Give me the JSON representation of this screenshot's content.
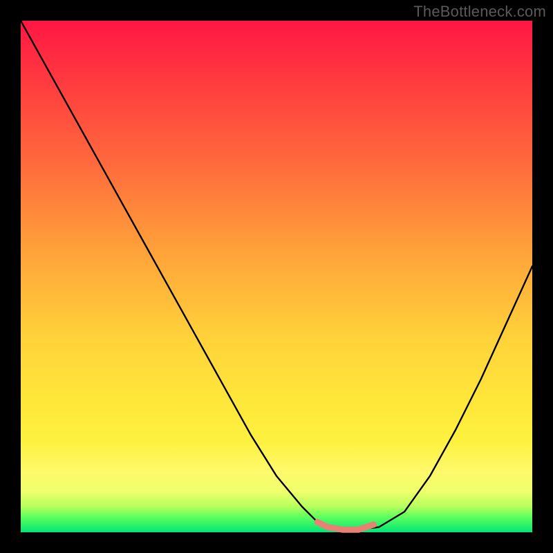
{
  "watermark": "TheBottleneck.com",
  "colors": {
    "frame_bg": "#000000",
    "curve_stroke": "#000000",
    "highlight_stroke": "#e98074",
    "gradient_top": "#ff1744",
    "gradient_bottom": "#00e676",
    "watermark_text": "#5a5a5a"
  },
  "chart_data": {
    "type": "line",
    "title": "",
    "xlabel": "",
    "ylabel": "",
    "xlim": [
      0,
      100
    ],
    "ylim": [
      0,
      100
    ],
    "annotations": [
      "TheBottleneck.com"
    ],
    "series": [
      {
        "name": "bottleneck_curve",
        "x": [
          0,
          5,
          10,
          15,
          20,
          25,
          30,
          35,
          40,
          45,
          50,
          55,
          58,
          60,
          63,
          66,
          70,
          75,
          80,
          85,
          90,
          95,
          100
        ],
        "y": [
          100,
          91,
          82,
          73,
          64,
          55,
          46,
          37,
          28,
          19,
          11,
          5,
          2,
          1,
          0.5,
          0.5,
          1,
          4,
          11,
          20,
          30,
          41,
          52
        ]
      },
      {
        "name": "optimal_range_highlight",
        "x": [
          58,
          60,
          63,
          66,
          69
        ],
        "y": [
          2,
          1,
          0.5,
          0.5,
          1.5
        ]
      }
    ],
    "optimal_range_x": [
      58,
      69
    ]
  }
}
